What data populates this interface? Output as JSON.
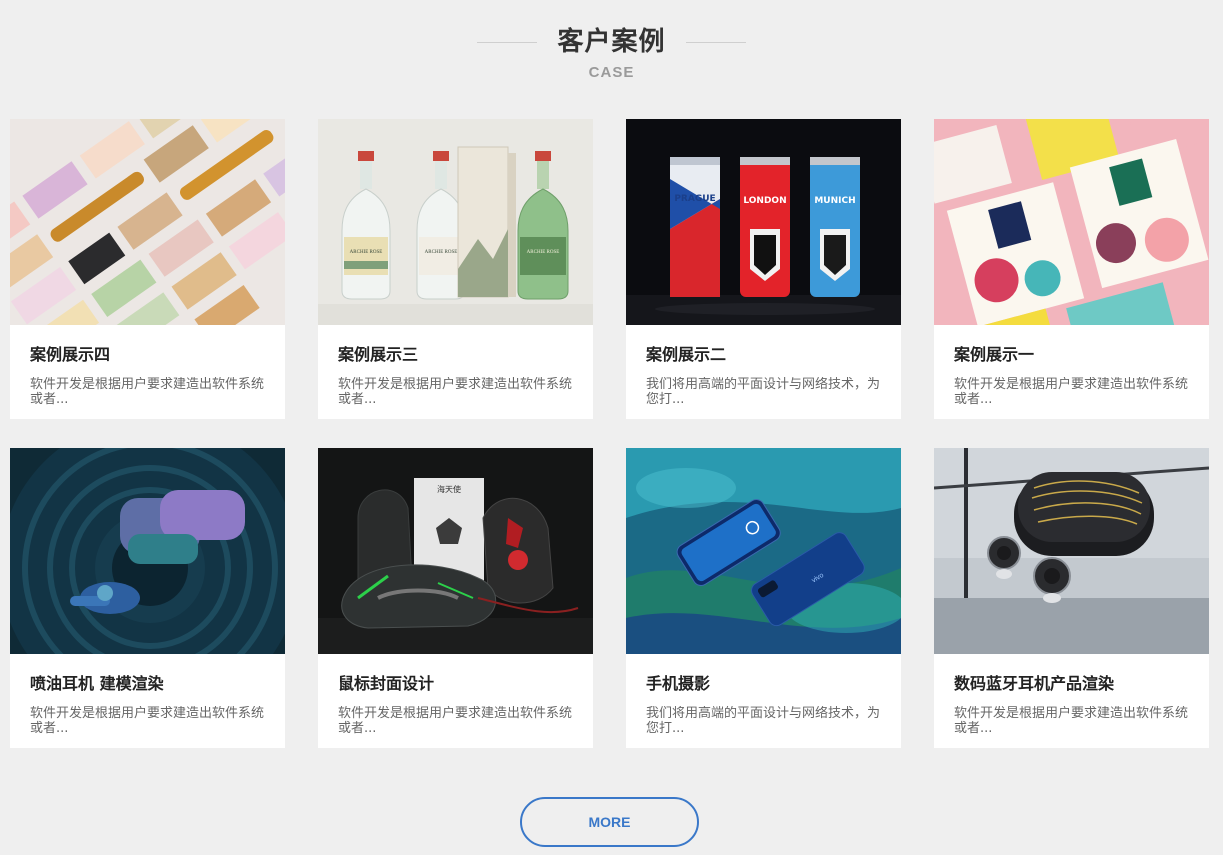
{
  "section": {
    "title": "客户案例",
    "subtitle": "CASE"
  },
  "cases": [
    {
      "title": "案例展示四",
      "desc": "软件开发是根据用户要求建造出软件系统或者..."
    },
    {
      "title": "案例展示三",
      "desc": "软件开发是根据用户要求建造出软件系统或者..."
    },
    {
      "title": "案例展示二",
      "desc": "我们将用高端的平面设计与网络技术，为您打..."
    },
    {
      "title": "案例展示一",
      "desc": "软件开发是根据用户要求建造出软件系统或者..."
    },
    {
      "title": "喷油耳机 建模渲染",
      "desc": "软件开发是根据用户要求建造出软件系统或者..."
    },
    {
      "title": "鼠标封面设计",
      "desc": "软件开发是根据用户要求建造出软件系统或者..."
    },
    {
      "title": "手机摄影",
      "desc": "我们将用高端的平面设计与网络技术，为您打..."
    },
    {
      "title": "数码蓝牙耳机产品渲染",
      "desc": "软件开发是根据用户要求建造出软件系统或者..."
    }
  ],
  "images": {
    "bottle_labels": [
      "ARCHIE ROSE",
      "ARCHIE ROSE",
      "ARCHIE ROSE"
    ],
    "can_labels": [
      "PRAGUE",
      "LONDON",
      "MUNICH"
    ],
    "box_label": "海天使"
  },
  "more_label": "MORE",
  "colors": {
    "accent": "#3a78c9",
    "background": "#efefef"
  }
}
